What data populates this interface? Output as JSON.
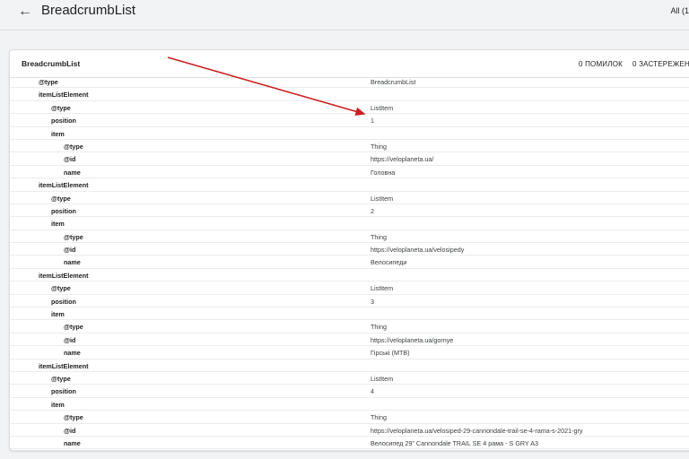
{
  "header": {
    "title": "BreadcrumbList",
    "filter_label": "All (1"
  },
  "card": {
    "title": "BreadcrumbList",
    "errors": "0 ПОМИЛОК",
    "warnings": "0 ЗАСТЕРЕЖЕН"
  },
  "rows": [
    {
      "key": "@type",
      "value": "BreadcrumbList",
      "depth": 0
    },
    {
      "key": "itemListElement",
      "value": "",
      "depth": 0
    },
    {
      "key": "@type",
      "value": "ListItem",
      "depth": 1
    },
    {
      "key": "position",
      "value": "1",
      "depth": 1
    },
    {
      "key": "item",
      "value": "",
      "depth": 1
    },
    {
      "key": "@type",
      "value": "Thing",
      "depth": 2
    },
    {
      "key": "@id",
      "value": "https://veloplaneta.ua/",
      "depth": 2
    },
    {
      "key": "name",
      "value": "Головна",
      "depth": 2
    },
    {
      "key": "itemListElement",
      "value": "",
      "depth": 0
    },
    {
      "key": "@type",
      "value": "ListItem",
      "depth": 1
    },
    {
      "key": "position",
      "value": "2",
      "depth": 1
    },
    {
      "key": "item",
      "value": "",
      "depth": 1
    },
    {
      "key": "@type",
      "value": "Thing",
      "depth": 2
    },
    {
      "key": "@id",
      "value": "https://veloplaneta.ua/velosipedy",
      "depth": 2
    },
    {
      "key": "name",
      "value": "Велосипеди",
      "depth": 2
    },
    {
      "key": "itemListElement",
      "value": "",
      "depth": 0
    },
    {
      "key": "@type",
      "value": "ListItem",
      "depth": 1
    },
    {
      "key": "position",
      "value": "3",
      "depth": 1
    },
    {
      "key": "item",
      "value": "",
      "depth": 1
    },
    {
      "key": "@type",
      "value": "Thing",
      "depth": 2
    },
    {
      "key": "@id",
      "value": "https://veloplaneta.ua/gornye",
      "depth": 2
    },
    {
      "key": "name",
      "value": "Гірські (MTB)",
      "depth": 2
    },
    {
      "key": "itemListElement",
      "value": "",
      "depth": 0
    },
    {
      "key": "@type",
      "value": "ListItem",
      "depth": 1
    },
    {
      "key": "position",
      "value": "4",
      "depth": 1
    },
    {
      "key": "item",
      "value": "",
      "depth": 1
    },
    {
      "key": "@type",
      "value": "Thing",
      "depth": 2
    },
    {
      "key": "@id",
      "value": "https://veloplaneta.ua/velosiped-29-cannondale-trail-se-4-rama-s-2021-gry",
      "depth": 2
    },
    {
      "key": "name",
      "value": "Велосипед 29\" Cannondale TRAIL SE 4 рама - S GRY A3",
      "depth": 2
    }
  ],
  "icons": {
    "back": "arrow-left-icon"
  },
  "colors": {
    "annotation_arrow": "#cc1f1f",
    "background": "#f1f3f4"
  }
}
